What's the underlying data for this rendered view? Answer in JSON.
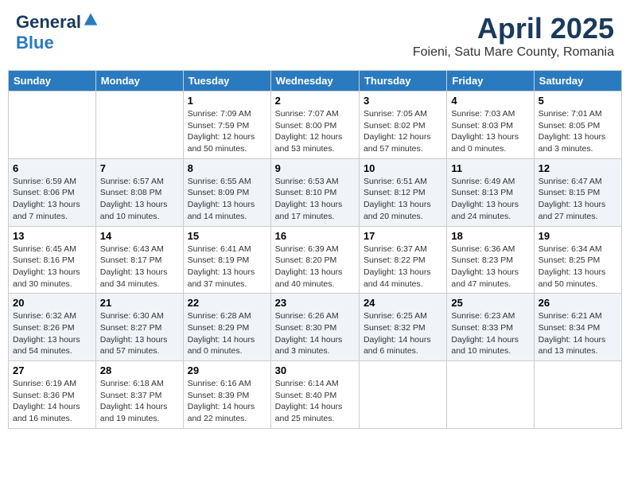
{
  "header": {
    "logo_general": "General",
    "logo_blue": "Blue",
    "title": "April 2025",
    "subtitle": "Foieni, Satu Mare County, Romania"
  },
  "days_of_week": [
    "Sunday",
    "Monday",
    "Tuesday",
    "Wednesday",
    "Thursday",
    "Friday",
    "Saturday"
  ],
  "weeks": [
    [
      {
        "day": "",
        "info": ""
      },
      {
        "day": "",
        "info": ""
      },
      {
        "day": "1",
        "info": "Sunrise: 7:09 AM\nSunset: 7:59 PM\nDaylight: 12 hours and 50 minutes."
      },
      {
        "day": "2",
        "info": "Sunrise: 7:07 AM\nSunset: 8:00 PM\nDaylight: 12 hours and 53 minutes."
      },
      {
        "day": "3",
        "info": "Sunrise: 7:05 AM\nSunset: 8:02 PM\nDaylight: 12 hours and 57 minutes."
      },
      {
        "day": "4",
        "info": "Sunrise: 7:03 AM\nSunset: 8:03 PM\nDaylight: 13 hours and 0 minutes."
      },
      {
        "day": "5",
        "info": "Sunrise: 7:01 AM\nSunset: 8:05 PM\nDaylight: 13 hours and 3 minutes."
      }
    ],
    [
      {
        "day": "6",
        "info": "Sunrise: 6:59 AM\nSunset: 8:06 PM\nDaylight: 13 hours and 7 minutes."
      },
      {
        "day": "7",
        "info": "Sunrise: 6:57 AM\nSunset: 8:08 PM\nDaylight: 13 hours and 10 minutes."
      },
      {
        "day": "8",
        "info": "Sunrise: 6:55 AM\nSunset: 8:09 PM\nDaylight: 13 hours and 14 minutes."
      },
      {
        "day": "9",
        "info": "Sunrise: 6:53 AM\nSunset: 8:10 PM\nDaylight: 13 hours and 17 minutes."
      },
      {
        "day": "10",
        "info": "Sunrise: 6:51 AM\nSunset: 8:12 PM\nDaylight: 13 hours and 20 minutes."
      },
      {
        "day": "11",
        "info": "Sunrise: 6:49 AM\nSunset: 8:13 PM\nDaylight: 13 hours and 24 minutes."
      },
      {
        "day": "12",
        "info": "Sunrise: 6:47 AM\nSunset: 8:15 PM\nDaylight: 13 hours and 27 minutes."
      }
    ],
    [
      {
        "day": "13",
        "info": "Sunrise: 6:45 AM\nSunset: 8:16 PM\nDaylight: 13 hours and 30 minutes."
      },
      {
        "day": "14",
        "info": "Sunrise: 6:43 AM\nSunset: 8:17 PM\nDaylight: 13 hours and 34 minutes."
      },
      {
        "day": "15",
        "info": "Sunrise: 6:41 AM\nSunset: 8:19 PM\nDaylight: 13 hours and 37 minutes."
      },
      {
        "day": "16",
        "info": "Sunrise: 6:39 AM\nSunset: 8:20 PM\nDaylight: 13 hours and 40 minutes."
      },
      {
        "day": "17",
        "info": "Sunrise: 6:37 AM\nSunset: 8:22 PM\nDaylight: 13 hours and 44 minutes."
      },
      {
        "day": "18",
        "info": "Sunrise: 6:36 AM\nSunset: 8:23 PM\nDaylight: 13 hours and 47 minutes."
      },
      {
        "day": "19",
        "info": "Sunrise: 6:34 AM\nSunset: 8:25 PM\nDaylight: 13 hours and 50 minutes."
      }
    ],
    [
      {
        "day": "20",
        "info": "Sunrise: 6:32 AM\nSunset: 8:26 PM\nDaylight: 13 hours and 54 minutes."
      },
      {
        "day": "21",
        "info": "Sunrise: 6:30 AM\nSunset: 8:27 PM\nDaylight: 13 hours and 57 minutes."
      },
      {
        "day": "22",
        "info": "Sunrise: 6:28 AM\nSunset: 8:29 PM\nDaylight: 14 hours and 0 minutes."
      },
      {
        "day": "23",
        "info": "Sunrise: 6:26 AM\nSunset: 8:30 PM\nDaylight: 14 hours and 3 minutes."
      },
      {
        "day": "24",
        "info": "Sunrise: 6:25 AM\nSunset: 8:32 PM\nDaylight: 14 hours and 6 minutes."
      },
      {
        "day": "25",
        "info": "Sunrise: 6:23 AM\nSunset: 8:33 PM\nDaylight: 14 hours and 10 minutes."
      },
      {
        "day": "26",
        "info": "Sunrise: 6:21 AM\nSunset: 8:34 PM\nDaylight: 14 hours and 13 minutes."
      }
    ],
    [
      {
        "day": "27",
        "info": "Sunrise: 6:19 AM\nSunset: 8:36 PM\nDaylight: 14 hours and 16 minutes."
      },
      {
        "day": "28",
        "info": "Sunrise: 6:18 AM\nSunset: 8:37 PM\nDaylight: 14 hours and 19 minutes."
      },
      {
        "day": "29",
        "info": "Sunrise: 6:16 AM\nSunset: 8:39 PM\nDaylight: 14 hours and 22 minutes."
      },
      {
        "day": "30",
        "info": "Sunrise: 6:14 AM\nSunset: 8:40 PM\nDaylight: 14 hours and 25 minutes."
      },
      {
        "day": "",
        "info": ""
      },
      {
        "day": "",
        "info": ""
      },
      {
        "day": "",
        "info": ""
      }
    ]
  ]
}
